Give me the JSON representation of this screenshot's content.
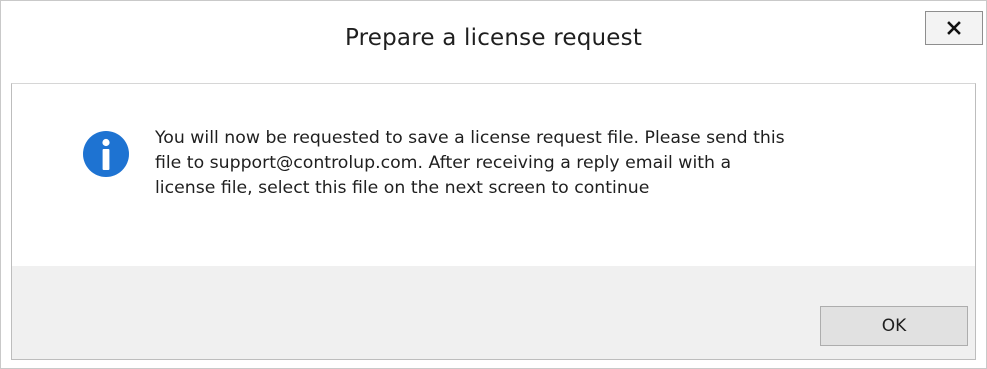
{
  "dialog": {
    "title": "Prepare a license request",
    "close_icon": "close-icon",
    "info_icon": "info-icon",
    "message_lines": [
      "You will now be requested to save a license request file. Please send this",
      "file to support@controlup.com. After receiving a reply email with a",
      "license file, select this file on the next screen to continue"
    ],
    "ok_label": "OK"
  },
  "colors": {
    "info_icon_fill": "#1e73d2",
    "footer_background": "#f0f0f0",
    "button_background": "#e1e1e1"
  }
}
